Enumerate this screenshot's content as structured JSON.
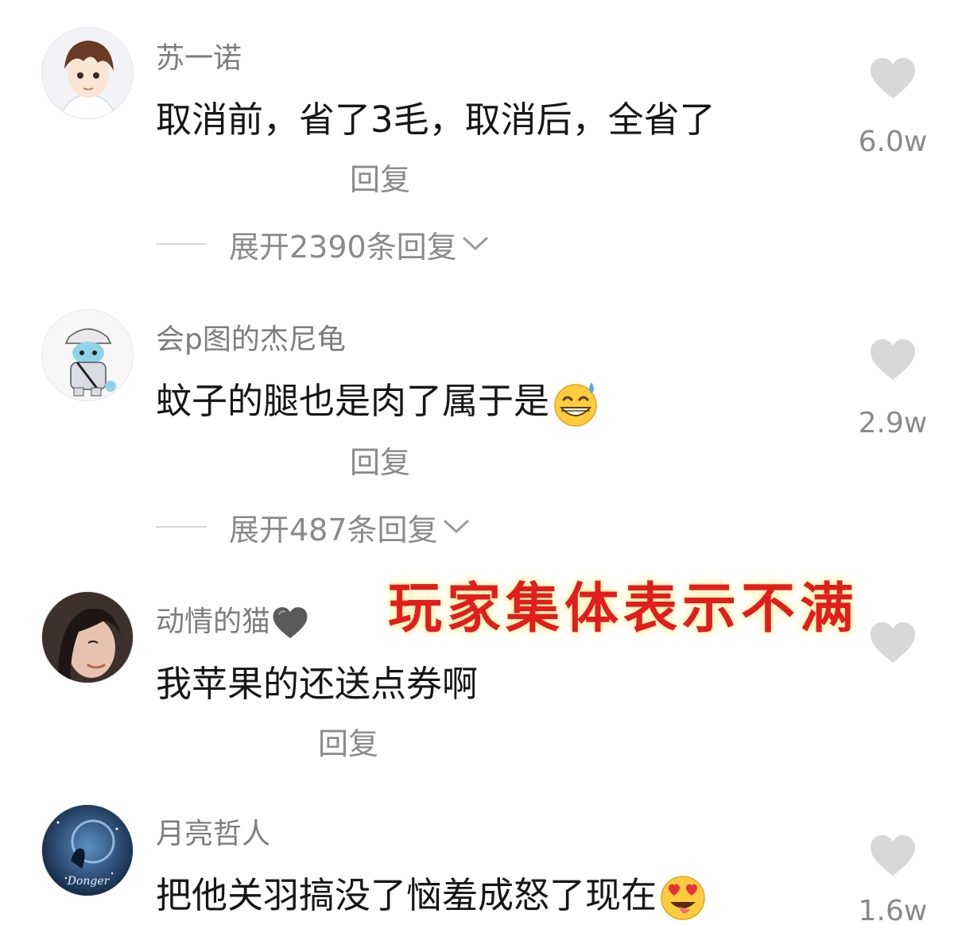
{
  "comments": [
    {
      "username": "苏一诺",
      "text": "取消前，省了3毛，取消后，全省了",
      "reply_label": "回复",
      "likes": "6.0w",
      "expand_label": "展开2390条回复"
    },
    {
      "username": "会p图的杰尼龟",
      "text": "蚊子的腿也是肉了属于是",
      "emoji": "grinning-sweat-emoji",
      "reply_label": "回复",
      "likes": "2.9w",
      "expand_label": "展开487条回复"
    },
    {
      "username": "动情的猫",
      "username_badge": "grey-heart-icon",
      "text": "我苹果的还送点券啊",
      "reply_label": "回复"
    },
    {
      "username": "月亮哲人",
      "text": "把他关羽搞没了恼羞成怒了现在",
      "emoji": "heart-eyes-tongue-emoji",
      "likes": "1.6w",
      "avatar_text": "Donger"
    }
  ],
  "overlay_caption": "玩家集体表示不满",
  "colors": {
    "username": "#7d7d7d",
    "body_text": "#161616",
    "meta": "#8a8a8a",
    "heart": "#d8d8d8",
    "caption": "#e01e1e"
  }
}
